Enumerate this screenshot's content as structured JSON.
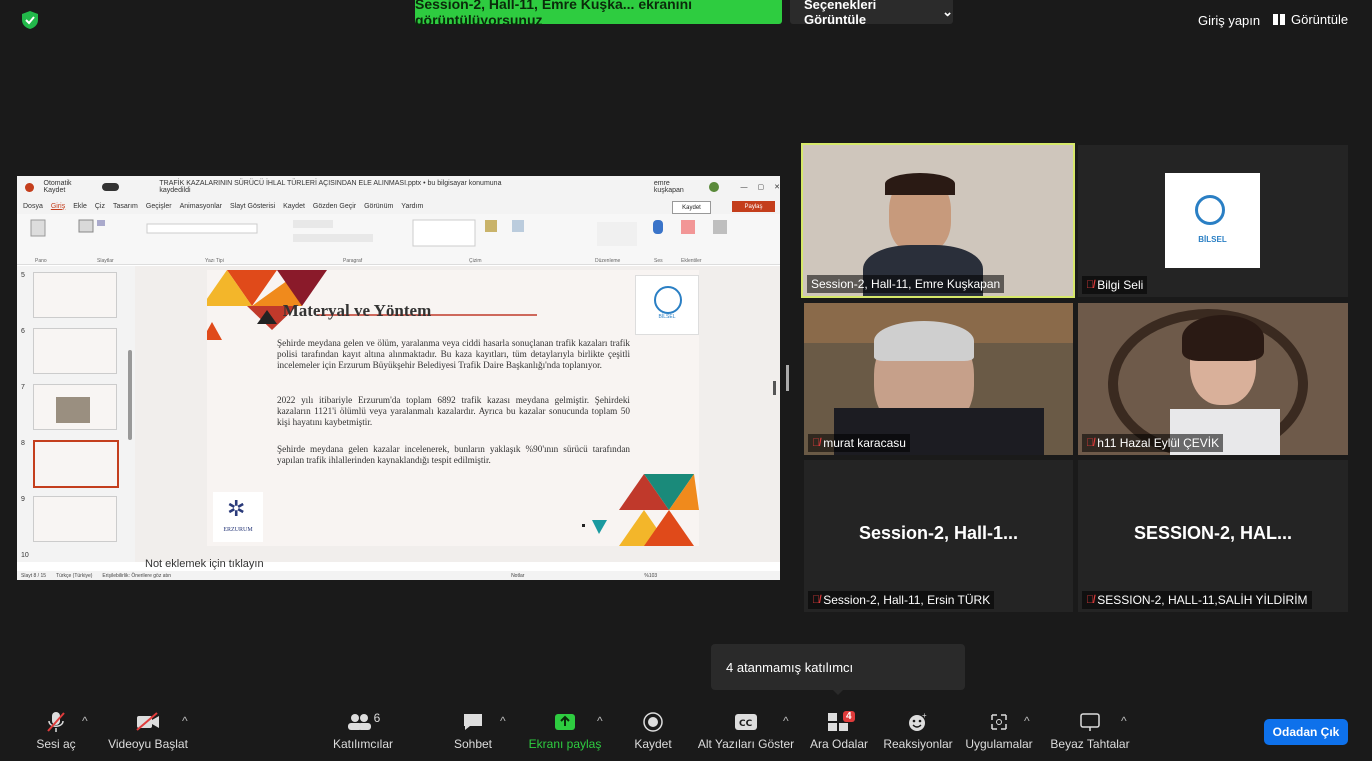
{
  "topbar": {
    "share_banner": "Session-2, Hall-11, Emre Kuşka... ekranını görüntülüyorsunuz",
    "view_options": "Seçenekleri Görüntüle",
    "signin": "Giriş yapın",
    "view": "Görüntüle"
  },
  "shared": {
    "window_title": "TRAFİK KAZALARININ SÜRÜCÜ İHLAL TÜRLERİ AÇISINDAN ELE ALINMASI.pptx • bu bilgisayar konumuna kaydedildi",
    "autosave": "Otomatik Kaydet",
    "user": "emre kuşkapan",
    "menu": [
      "Dosya",
      "Giriş",
      "Ekle",
      "Çiz",
      "Tasarım",
      "Geçişler",
      "Animasyonlar",
      "Slayt Gösterisi",
      "Kaydet",
      "Gözden Geçir",
      "Görünüm",
      "Yardım"
    ],
    "kaydet": "Kaydet",
    "paylas": "Paylaş",
    "ribbon_groups": [
      "Pano",
      "Slaytlar",
      "Yazı Tipi",
      "Paragraf",
      "Çizim",
      "Düzenleme",
      "Ses",
      "Eklentiler"
    ],
    "thumb_numbers": [
      "5",
      "6",
      "7",
      "8",
      "9",
      "10"
    ],
    "slide_title": "Materyal ve Yöntem",
    "slide_paragraphs": [
      "Şehirde meydana gelen ve ölüm, yaralanma veya ciddi hasarla sonuçlanan trafik kazaları trafik polisi tarafından kayıt altına alınmaktadır. Bu kaza kayıtları, tüm detaylarıyla birlikte çeşitli incelemeler için Erzurum Büyükşehir Belediyesi Trafik Daire Başkanlığı'nda toplanıyor.",
      "2022 yılı itibariyle Erzurum'da toplam 6892 trafik kazası meydana gelmiştir. Şehirdeki kazaların 1121'i ölümlü veya yaralanmalı kazalardır. Ayrıca bu kazalar sonucunda toplam 50 kişi hayatını kaybetmiştir.",
      "Şehirde meydana gelen kazalar incelenerek, bunların yaklaşık %90'ının sürücü tarafından yapılan trafik ihlallerinden kaynaklandığı tespit edilmiştir."
    ],
    "slide_logo_bottom": "ERZURUM",
    "slide_logo_top": "BİLSEL",
    "notes": "Not eklemek için tıklayın",
    "status_left": "Slayt 8 / 15",
    "status_lang": "Türkçe (Türkiye)",
    "status_access": "Erişilebilirlik: Önerilere göz atın",
    "status_notes": "Notlar",
    "zoom": "%103"
  },
  "tiles": [
    {
      "name": "Session-2, Hall-11, Emre Kuşkapan",
      "muted": false
    },
    {
      "name": "Bilgi Seli",
      "muted": true,
      "logo": "BİLSEL"
    },
    {
      "name": "murat karacasu",
      "muted": true
    },
    {
      "name": "h11 Hazal Eylül ÇEVİK",
      "muted": true
    },
    {
      "name": "Session-2, Hall-11, Ersin TÜRK",
      "muted": true,
      "big": "Session-2,  Hall-1..."
    },
    {
      "name": "SESSION-2, HALL-11,SALİH YİLDİRİM",
      "muted": true,
      "big": "SESSION-2,  HAL..."
    }
  ],
  "popup": "4 atanmamış katılımcı",
  "toolbar": {
    "unmute": "Sesi aç",
    "video": "Videoyu Başlat",
    "participants": "Katılımcılar",
    "participants_count": "6",
    "chat": "Sohbet",
    "share": "Ekranı paylaş",
    "record": "Kaydet",
    "captions": "Alt Yazıları Göster",
    "breakout": "Ara Odalar",
    "breakout_badge": "4",
    "reactions": "Reaksiyonlar",
    "apps": "Uygulamalar",
    "whiteboard": "Beyaz Tahtalar",
    "leave": "Odadan Çık"
  },
  "colors": {
    "share_green": "#2ecc40",
    "leave_blue": "#0e71eb",
    "muted_red": "#e03b3b",
    "tile_highlight": "#d6e86a"
  }
}
